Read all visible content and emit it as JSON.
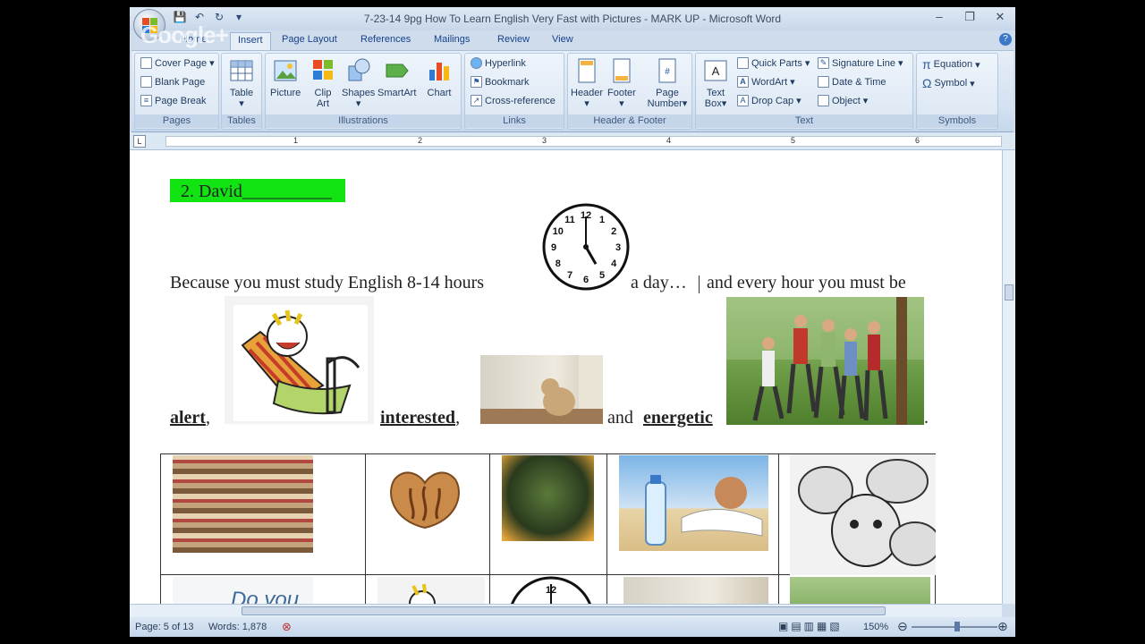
{
  "window": {
    "title": "7-23-14 9pg How To Learn English Very Fast with Pictures -  MARK UP - Microsoft Word",
    "controls": [
      "–",
      "❐",
      "✕"
    ]
  },
  "watermark": "Google+",
  "tabs": [
    "Home",
    "Insert",
    "Page Layout",
    "References",
    "Mailings",
    "Review",
    "View"
  ],
  "ribbon": {
    "pages": {
      "label": "Pages",
      "items": [
        "Cover Page",
        "Blank Page",
        "Page Break"
      ]
    },
    "tables": {
      "label": "Tables",
      "items": [
        "Table"
      ]
    },
    "illustrations": {
      "label": "Illustrations",
      "items": [
        "Picture",
        "Clip Art",
        "Shapes",
        "SmartArt",
        "Chart"
      ]
    },
    "links": {
      "label": "Links",
      "items": [
        "Hyperlink",
        "Bookmark",
        "Cross-reference"
      ]
    },
    "header_footer": {
      "label": "Header & Footer",
      "items": [
        "Header",
        "Footer",
        "Page Number"
      ]
    },
    "text": {
      "label": "Text",
      "items": [
        "Text Box",
        "Quick Parts",
        "WordArt",
        "Drop Cap",
        "Signature Line",
        "Date & Time",
        "Object"
      ]
    },
    "symbols": {
      "label": "Symbols",
      "items": [
        "Equation",
        "Symbol"
      ]
    }
  },
  "ruler": {
    "numbers": [
      "1",
      "2",
      "3",
      "4",
      "5",
      "6"
    ]
  },
  "document": {
    "heading": "2. David__________",
    "line1_left": "Because you must study English 8-14 hours",
    "line1_right": "a day…",
    "line1_tail": "and every hour you must be",
    "word_alert": "alert",
    "comma": ",",
    "word_interested": "interested",
    "and": "and",
    "word_energetic": "energetic",
    "period": ".",
    "row2_text": "Do you"
  },
  "clock": {
    "numbers": [
      "12",
      "1",
      "2",
      "3",
      "4",
      "5",
      "6",
      "7",
      "8",
      "9",
      "10",
      "11"
    ],
    "hour": 5,
    "minute": 0
  },
  "status": {
    "page": "Page: 5 of 13",
    "words": "Words: 1,878",
    "zoom": "150%"
  },
  "colors": {
    "highlight": "#12e312",
    "ribbon_text": "#15428b"
  }
}
